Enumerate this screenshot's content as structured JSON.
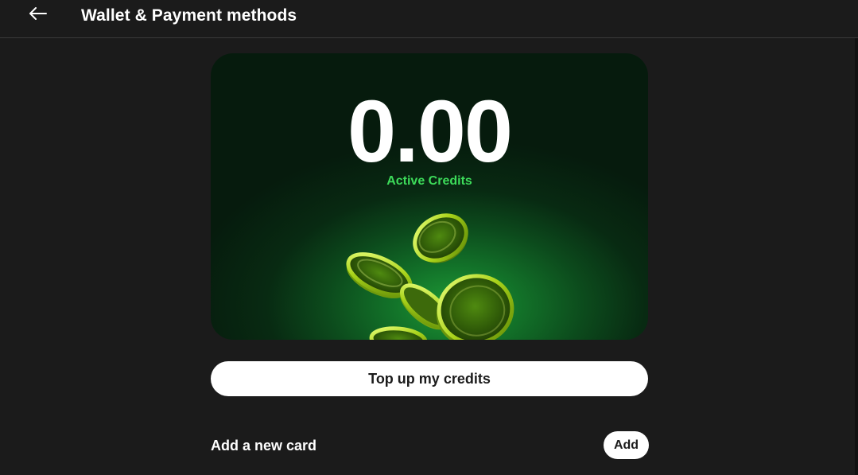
{
  "header": {
    "back_icon": "arrow-left-icon",
    "title": "Wallet & Payment methods"
  },
  "wallet": {
    "credits_value": "0.00",
    "credits_label": "Active Credits",
    "accent_color": "#3ddc5a",
    "illustration": "falling-coins"
  },
  "actions": {
    "topup_label": "Top up my credits",
    "add_card_label": "Add a new card",
    "add_button_label": "Add"
  },
  "colors": {
    "background": "#1b1b1b",
    "button_bg": "#ffffff",
    "button_text": "#1b1b1b"
  }
}
